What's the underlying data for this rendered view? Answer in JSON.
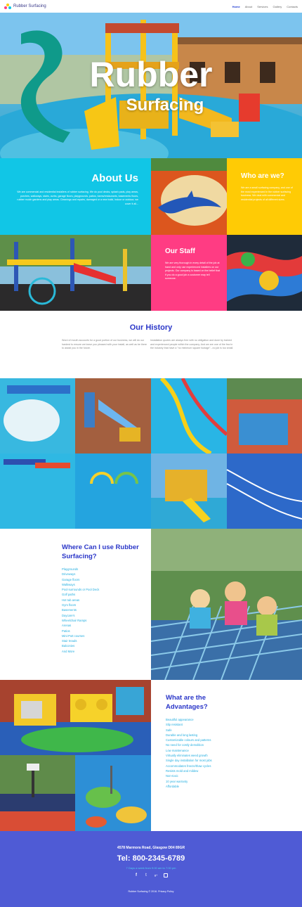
{
  "header": {
    "brand": "Rubber Surfacing",
    "nav": [
      "Home",
      "About",
      "Services",
      "Gallery",
      "Contacts"
    ]
  },
  "hero": {
    "title": "Rubber",
    "subtitle": "Surfacing"
  },
  "about": {
    "title": "About Us",
    "text": "We are commercial and residential installers of rubber surfacing. We do pool decks, splash pads, play areas, porches, walkways, stairs, curbs, garage floors, playgrounds, patios, barns/restaurants, basements floors, rubber mulch gardens and play areas. Cleanings and repairs, damaged or a new build, indoor or outdoor, we cover it all..."
  },
  "who": {
    "title": "Who are we?",
    "text": "We are a small surfacing company, and one of the most experienced in the rubber surfacing business. We deal with commercial and residential projects of all different sizes."
  },
  "staff": {
    "title": "Our Staff",
    "text": "We are very thorough in every detail of the job at hand and only use experienced installers on our projects. Our company is based on the belief that if you do a good job a customer may tell someone."
  },
  "history": {
    "title": "Our History",
    "col1": "Word of mouth accounts for a good portion of our business, we will do our hardest to ensure we leave you pleased with your install, as well as be there to assist you in the future.",
    "col2": "Installation quotes are always free with no obligation and done by trained and experienced people within the company. And we are one of the few in the industry that have a \"no minimum square footage\"...no job is too small."
  },
  "uses": {
    "title": "Where Can I use Rubber Surfacing?",
    "items": [
      "Playgrounds",
      "Driveways",
      "Garage floors",
      "Walkways",
      "Pool surrounds or Pool Deck",
      "Golf paths",
      "Hot tub areas",
      "Gym floors",
      "Basements",
      "Daycare's",
      "Wheelchair Ramps",
      "Arenas",
      "Patios",
      "Mini-Putt courses",
      "Stair treads",
      "Balconies",
      "And More"
    ]
  },
  "advantages": {
    "title": "What are the Advantages?",
    "items": [
      "Beautiful appearance",
      "Slip resistant",
      "Safe",
      "Durable and long lasting",
      "Customizable colours and patterns",
      "No need for costly demolition",
      "Low maintenance",
      "Virtually eliminates weed growth",
      "Single day installation for most jobs",
      "Accommodates freeze/thaw cycles",
      "Resists mold and mildew",
      "Non-toxic",
      "10 year warranty",
      "Affordable"
    ]
  },
  "footer": {
    "address": "4578 Marmora Road, Glasgow D04 89GR",
    "phone": "Tel: 800-2345-6789",
    "hours": "7 Days a week from 9:00 am to 7:00 pm",
    "social": [
      "f",
      "t",
      "g+",
      "ig"
    ],
    "copyright": "Rubber Surfacing © 2016. Privacy Policy"
  },
  "colors": {
    "cyan": "#11c6e6",
    "yellow": "#ffcb05",
    "pink": "#ff3c83",
    "blue": "#2a36c8",
    "footer": "#4f5bd5",
    "listText": "#24aee0"
  }
}
